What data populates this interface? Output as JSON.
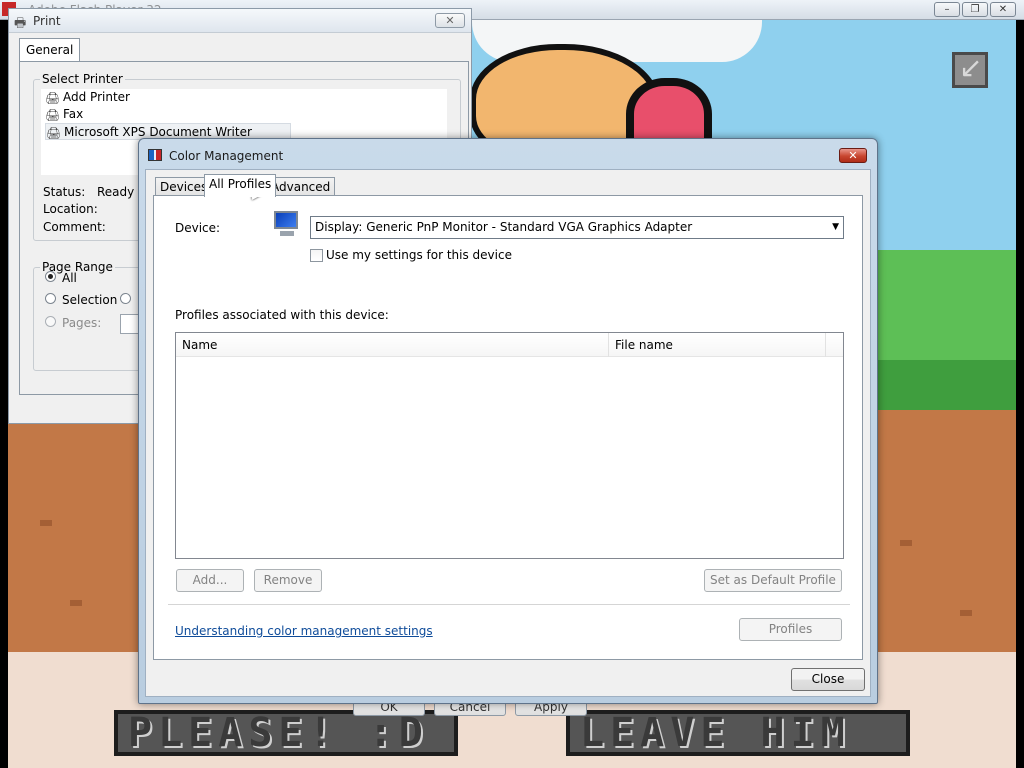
{
  "host": {
    "title": "Adobe Flash Player 32",
    "controls": [
      "–",
      "❐",
      "✕"
    ]
  },
  "game": {
    "button_left": "PLEASE! :D",
    "button_right": "LEAVE HIM"
  },
  "print_dialog": {
    "title": "Print",
    "close": "✕",
    "tab": "General",
    "select_printer_label": "Select Printer",
    "printers": [
      "Add Printer",
      "Fax",
      "Microsoft XPS Document Writer"
    ],
    "status_label": "Status:",
    "status_value": "Ready",
    "location_label": "Location:",
    "comment_label": "Comment:",
    "page_range_label": "Page Range",
    "range_all": "All",
    "range_selection": "Selection",
    "range_pages": "Pages:",
    "buttons": [
      "OK",
      "Cancel",
      "Apply"
    ]
  },
  "color_mgmt": {
    "title": "Color Management",
    "close": "✕",
    "tabs": [
      "Devices",
      "All Profiles",
      "Advanced"
    ],
    "device_label": "Device:",
    "device_value": "Display: Generic PnP Monitor - Standard VGA Graphics Adapter",
    "use_settings_label": "Use my settings for this device",
    "profiles_label": "Profiles associated with this device:",
    "columns": [
      "Name",
      "File name"
    ],
    "add_button": "Add...",
    "remove_button": "Remove",
    "set_default_button": "Set as Default Profile",
    "link": "Understanding color management settings",
    "profiles_button": "Profiles",
    "close_button": "Close"
  }
}
